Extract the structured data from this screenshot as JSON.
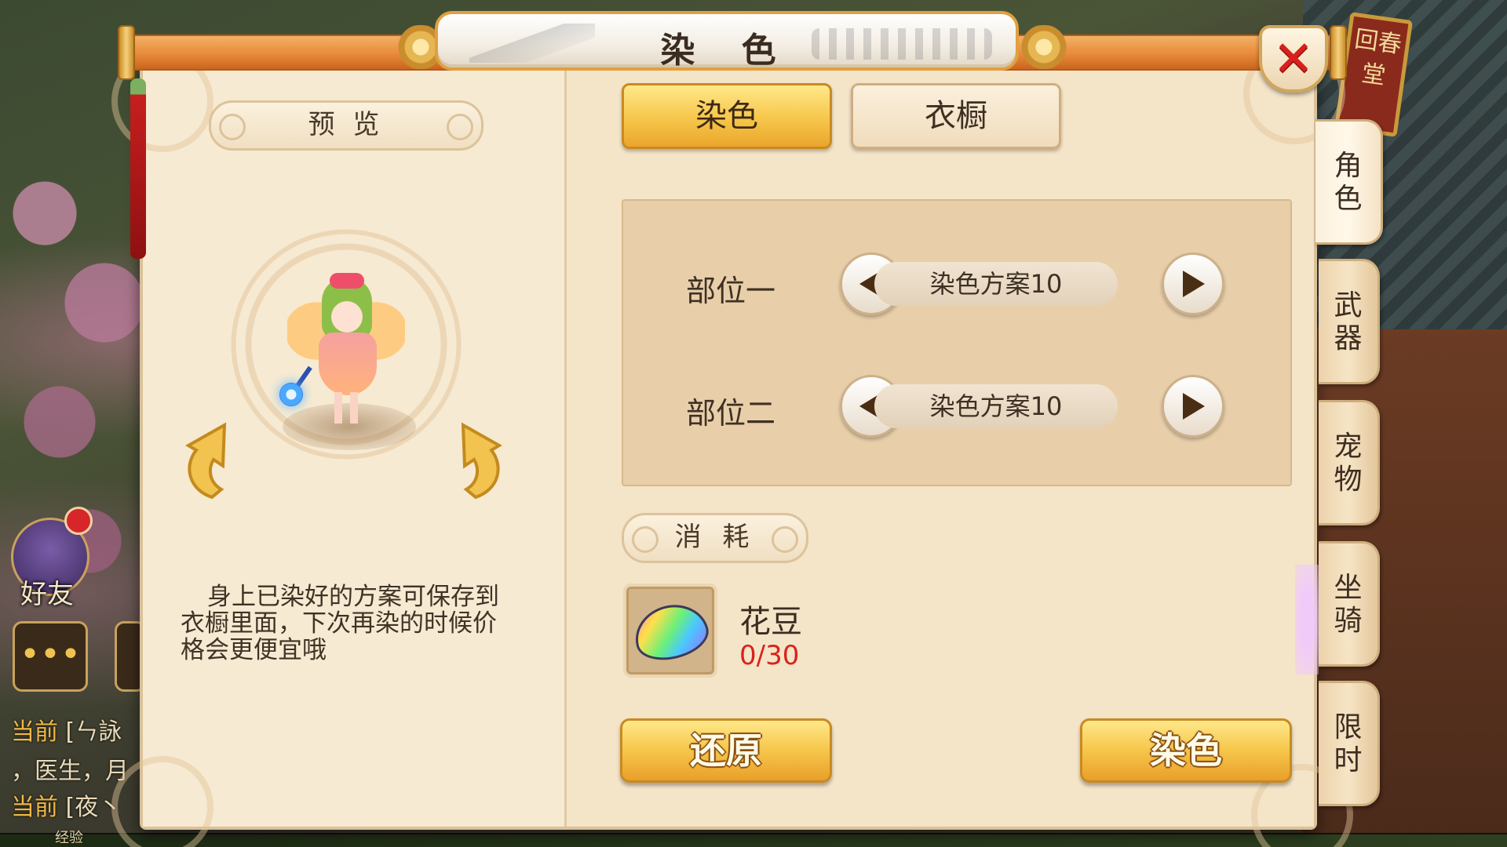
{
  "window": {
    "title": "染 色",
    "close_icon": "✕"
  },
  "background": {
    "sign_text": "回春堂",
    "friend_label": "好友",
    "chat_icon": "•••",
    "chat_lines": [
      {
        "tag": "当前",
        "text": "[ㄣ詠"
      },
      {
        "tag": "",
        "text": "，医生，月"
      },
      {
        "tag": "当前",
        "text": "[夜丶"
      }
    ],
    "exp_label": "经验"
  },
  "preview": {
    "title": "预 览",
    "tip": "身上已染好的方案可保存到衣橱里面，下次再染的时候价格会更便宜哦"
  },
  "tabs": [
    {
      "label": "染色",
      "active": true
    },
    {
      "label": "衣橱",
      "active": false
    }
  ],
  "parts": [
    {
      "label": "部位一",
      "scheme": "染色方案10"
    },
    {
      "label": "部位二",
      "scheme": "染色方案10"
    }
  ],
  "cost": {
    "title": "消 耗",
    "item_name": "花豆",
    "item_count": "0/30"
  },
  "buttons": {
    "restore": "还原",
    "dye": "染色"
  },
  "side_tabs": [
    {
      "label": "角色",
      "active": true
    },
    {
      "label": "武器",
      "active": false
    },
    {
      "label": "宠物",
      "active": false
    },
    {
      "label": "坐骑",
      "active": false
    },
    {
      "label": "限时",
      "active": false
    }
  ],
  "colors": {
    "accent_gold": "#f6c64a",
    "title_orange": "#e8893a",
    "count_red": "#d9221c",
    "panel_bg": "#f4e4c8"
  }
}
